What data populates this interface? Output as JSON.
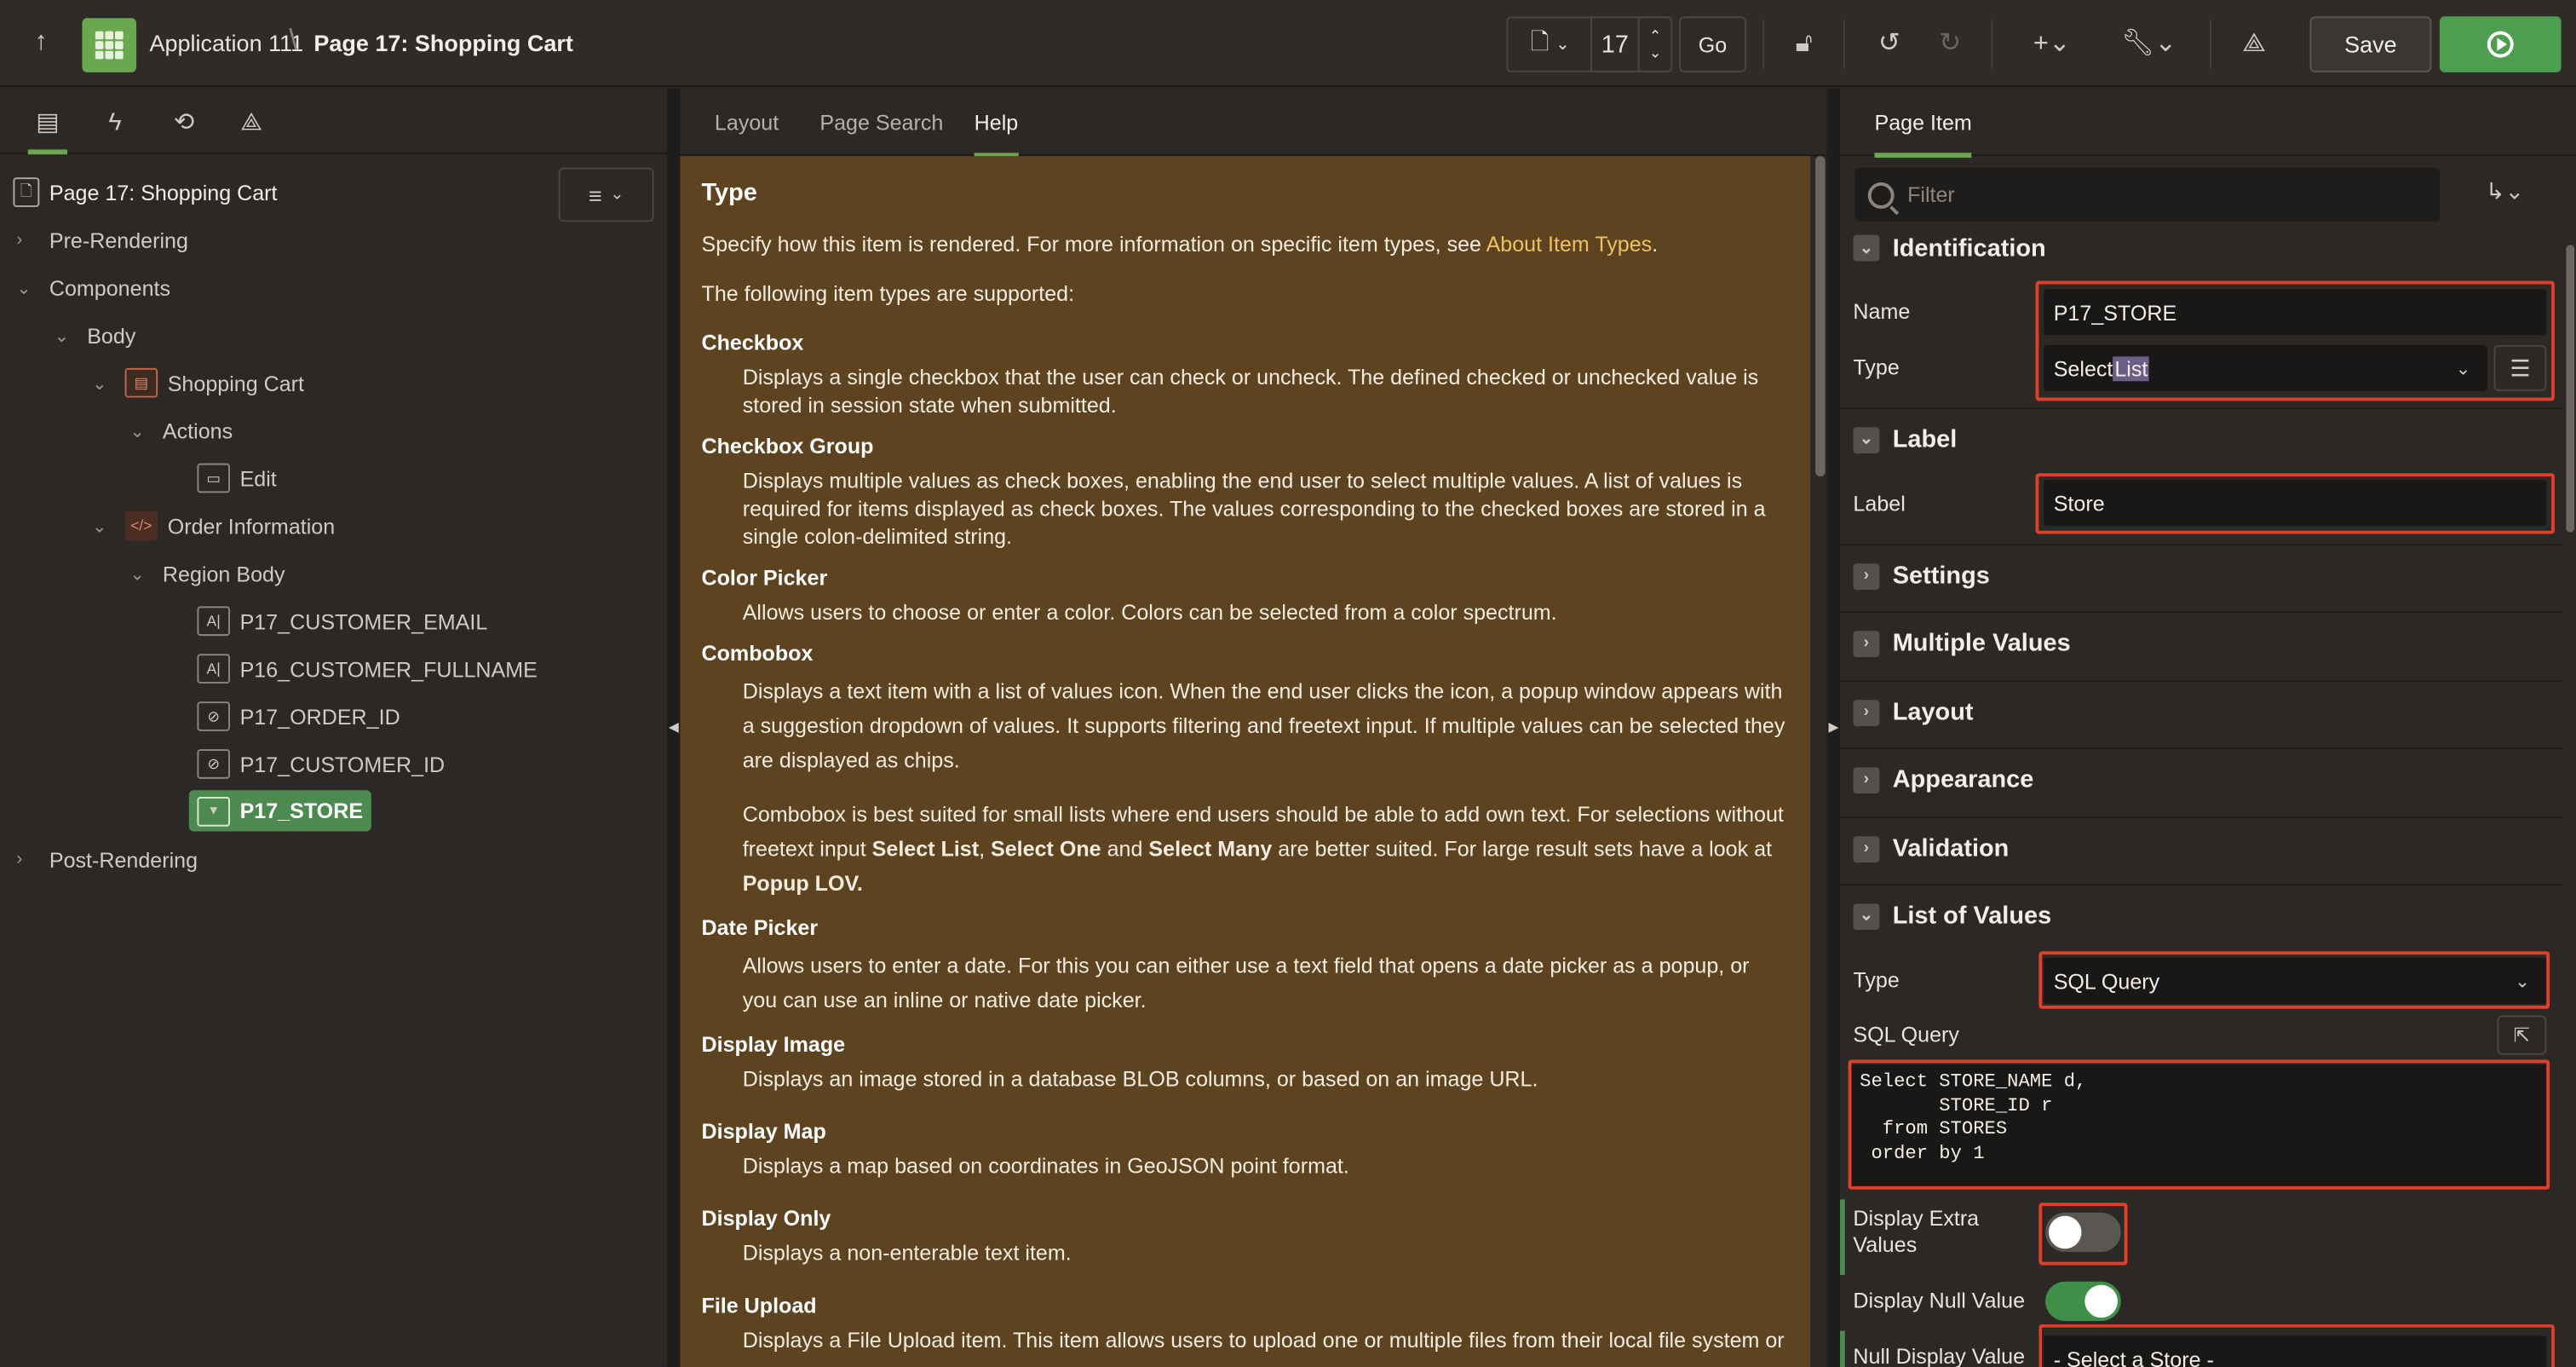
{
  "header": {
    "app_name": "Application 111",
    "separator": "\\",
    "page_title": "Page 17: Shopping Cart",
    "page_number": "17",
    "go_label": "Go",
    "save_label": "Save"
  },
  "left": {
    "root_title": "Page 17: Shopping Cart",
    "tree": [
      {
        "label": "Pre-Rendering",
        "chev": "›"
      },
      {
        "label": "Components",
        "chev": "⌄"
      },
      {
        "label": "Body",
        "chev": "⌄"
      },
      {
        "label": "Shopping Cart",
        "chev": "⌄"
      },
      {
        "label": "Actions",
        "chev": "⌄"
      },
      {
        "label": "Edit"
      },
      {
        "label": "Order Information",
        "chev": "⌄"
      },
      {
        "label": "Region Body",
        "chev": "⌄"
      },
      {
        "label": "P17_CUSTOMER_EMAIL"
      },
      {
        "label": "P16_CUSTOMER_FULLNAME"
      },
      {
        "label": "P17_ORDER_ID"
      },
      {
        "label": "P17_CUSTOMER_ID"
      },
      {
        "label": "P17_STORE"
      },
      {
        "label": "Post-Rendering",
        "chev": "›"
      }
    ]
  },
  "center": {
    "tabs": [
      "Layout",
      "Page Search",
      "Help"
    ],
    "help": {
      "heading": "Type",
      "intro": "Specify how this item is rendered. For more information on specific item types, see ",
      "intro_link": "About Item Types",
      "intro_end": ".",
      "supported": "The following item types are supported:",
      "items": [
        {
          "term": "Checkbox",
          "desc": [
            "Displays a single checkbox that the user can check or uncheck. The defined checked or unchecked value is stored in session state when submitted."
          ]
        },
        {
          "term": "Checkbox Group",
          "desc": [
            "Displays multiple values as check boxes, enabling the end user to select multiple values. A list of values is required for items displayed as check boxes. The values corresponding to the checked boxes are stored in a single colon-delimited string."
          ]
        },
        {
          "term": "Color Picker",
          "desc": [
            "Allows users to choose or enter a color. Colors can be selected from a color spectrum."
          ]
        },
        {
          "term": "Combobox",
          "desc": [
            "Displays a text item with a list of values icon. When the end user clicks the icon, a popup window appears with a suggestion dropdown of values. It supports filtering and freetext input. If multiple values can be selected they are displayed as chips."
          ]
        },
        {
          "term": "Date Picker",
          "desc": [
            "Allows users to enter a date. For this you can either use a text field that opens a date picker as a popup, or you can use an inline or native date picker."
          ]
        },
        {
          "term": "Display Image",
          "desc": [
            "Displays an image stored in a database BLOB columns, or based on an image URL."
          ]
        },
        {
          "term": "Display Map",
          "desc": [
            "Displays a map based on coordinates in GeoJSON point format."
          ]
        },
        {
          "term": "Display Only",
          "desc": [
            "Displays a non-enterable text item."
          ]
        },
        {
          "term": "File Upload",
          "desc": [
            "Displays a File Upload item. This item allows users to upload one or multiple files from their local file system or"
          ]
        }
      ],
      "combobox_note_1": "Combobox is best suited for small lists where end users should be able to add own text. For selections without freetext input ",
      "combobox_note_b1": "Select List",
      "combobox_note_2": ", ",
      "combobox_note_b2": "Select One",
      "combobox_note_3": " and ",
      "combobox_note_b3": "Select Many",
      "combobox_note_4": " are better suited. For large result sets have a look at ",
      "combobox_note_b4": "Popup LOV."
    }
  },
  "right": {
    "tab": "Page Item",
    "filter_placeholder": "Filter",
    "groups": {
      "identification": "Identification",
      "label": "Label",
      "settings": "Settings",
      "multiple_values": "Multiple Values",
      "layout": "Layout",
      "appearance": "Appearance",
      "validation": "Validation",
      "list_of_values": "List of Values"
    },
    "props": {
      "name_label": "Name",
      "name_value": "P17_STORE",
      "type_label": "Type",
      "type_value_a": "Select ",
      "type_value_b": "List",
      "label_label": "Label",
      "label_value": "Store",
      "lov_type_label": "Type",
      "lov_type_value": "SQL Query",
      "sql_label": "SQL Query",
      "sql_value": "Select STORE_NAME d,\n       STORE_ID r\n  from STORES\n order by 1",
      "extra_values_label": "Display Extra Values",
      "extra_values_on": false,
      "null_value_label": "Display Null Value",
      "null_value_on": true,
      "null_display_label": "Null Display Value",
      "null_display_value": "- Select a Store -"
    }
  },
  "colors": {
    "accent_green": "#6aa84f",
    "help_bg": "#5e4320",
    "highlight_red": "#e0402a",
    "run_green": "#4d9e4f"
  }
}
